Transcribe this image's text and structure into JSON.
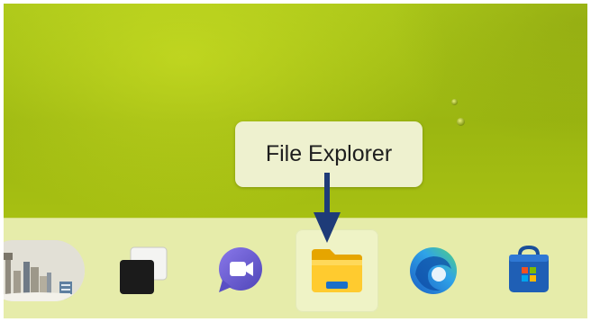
{
  "tooltip": {
    "text": "File Explorer"
  },
  "taskbar": {
    "items": [
      {
        "name": "widgets",
        "icon": "city-skyline-icon"
      },
      {
        "name": "task-view",
        "icon": "task-view-icon"
      },
      {
        "name": "chat",
        "icon": "teams-chat-icon"
      },
      {
        "name": "file-explorer",
        "icon": "folder-icon",
        "active": true
      },
      {
        "name": "edge",
        "icon": "edge-icon"
      },
      {
        "name": "store",
        "icon": "store-icon"
      }
    ]
  },
  "colors": {
    "wallpaper": "#a9c519",
    "taskbar": "#e6ecaa",
    "tooltip_bg": "#eef1cf",
    "arrow": "#1e3b78"
  }
}
